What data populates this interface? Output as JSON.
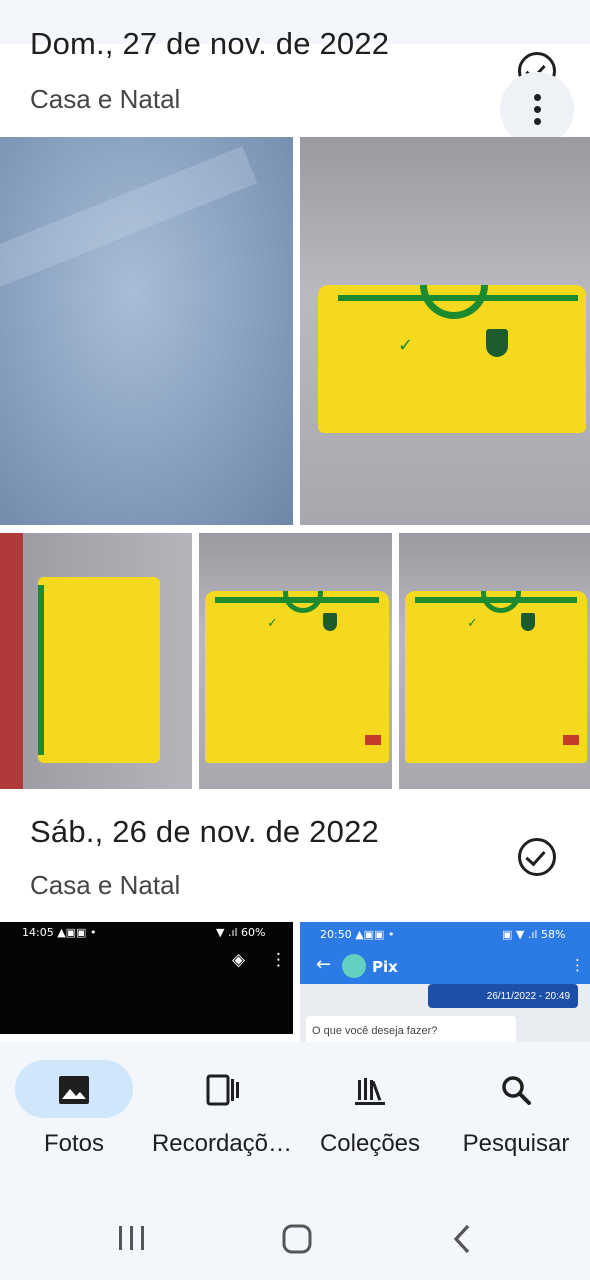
{
  "sections": [
    {
      "date": "Dom., 27 de nov. de 2022",
      "place": "Casa e Natal"
    },
    {
      "date": "Sáb., 26 de nov. de 2022",
      "place": "Casa e Natal"
    }
  ],
  "screenshots": {
    "left_status": "14:05 ▲▣▣ •",
    "left_battery": "▼ .ıl 60%",
    "right_status": "20:50 ▲▣▣ •",
    "right_battery": "▣ ▼ .ıl 58%",
    "pix_title": "Pix",
    "pix_timestamp": "26/11/2022 - 20:49",
    "pix_message": "O que você deseja fazer?"
  },
  "bottom_nav": {
    "items": [
      {
        "label": "Fotos",
        "icon": "photo-icon",
        "active": true
      },
      {
        "label": "Recordaçõ…",
        "icon": "memories-icon",
        "active": false
      },
      {
        "label": "Coleções",
        "icon": "library-icon",
        "active": false
      },
      {
        "label": "Pesquisar",
        "icon": "search-icon",
        "active": false
      }
    ]
  },
  "colors": {
    "active_pill": "#cfe6fb",
    "nav_bg": "#f3f6fb",
    "jersey_yellow": "#f4d91e",
    "jersey_green": "#1c8a2e"
  }
}
